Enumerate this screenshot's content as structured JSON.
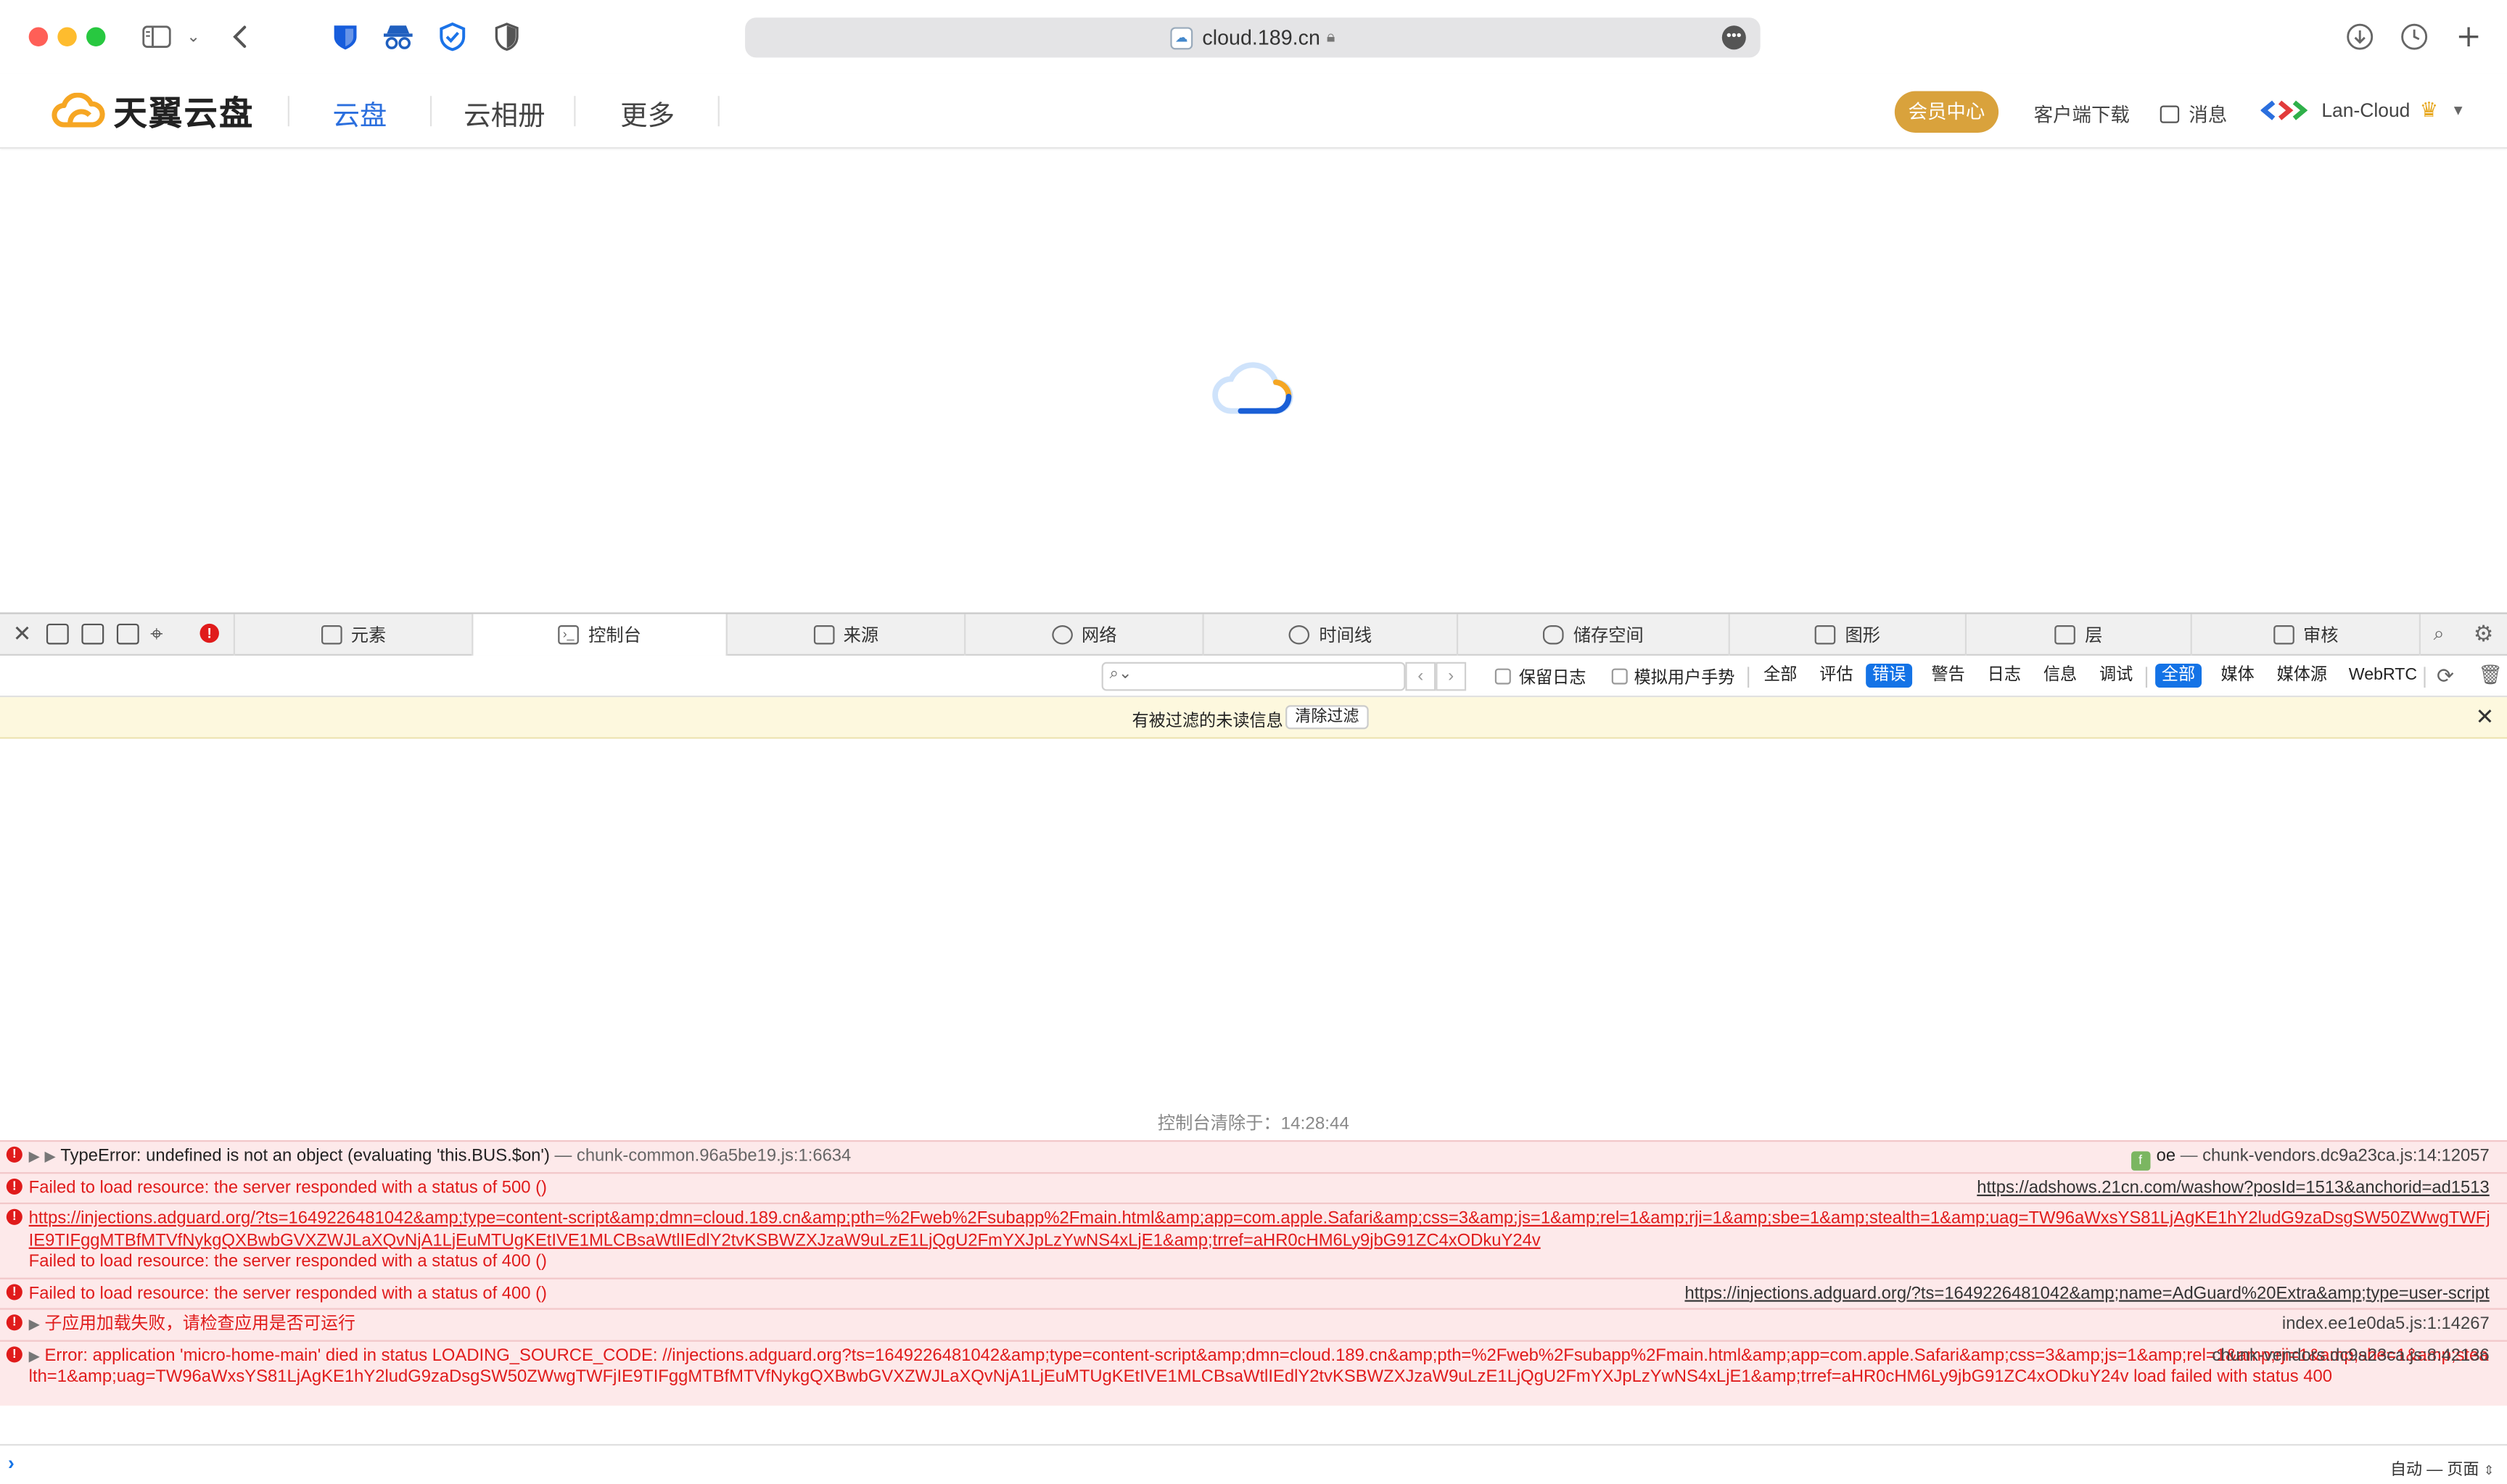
{
  "browser": {
    "url": "cloud.189.cn",
    "traffic_colors": {
      "close": "#ff5f57",
      "min": "#febc2e",
      "max": "#28c840"
    }
  },
  "site": {
    "logo_text": "天翼云盘",
    "nav": [
      "云盘",
      "云相册",
      "更多"
    ],
    "vip_label": "会员中心",
    "download_label": "客户端下载",
    "message_label": "消息",
    "user_name": "Lan-Cloud",
    "accent_color": "#2b6fde",
    "vip_color": "#d9a23c"
  },
  "devtools": {
    "tabs": [
      "元素",
      "控制台",
      "来源",
      "网络",
      "时间线",
      "储存空间",
      "图形",
      "层",
      "审核"
    ],
    "active_tab": "控制台",
    "filter_placeholder": "",
    "preserve_log_label": "保留日志",
    "simulate_gesture_label": "模拟用户手势",
    "level_filters": [
      "全部",
      "评估",
      "错误",
      "警告",
      "日志",
      "信息",
      "调试"
    ],
    "active_level": "错误",
    "source_filters": [
      "全部",
      "媒体",
      "媒体源",
      "WebRTC"
    ],
    "active_source": "全部",
    "notice_text": "有被过滤的未读信息",
    "notice_button": "清除过滤",
    "clear_note": "控制台清除于：14:28:44",
    "prompt_context": "自动 — 页面",
    "error_color": "#e01b1b"
  },
  "logs": [
    {
      "message": "TypeError: undefined is not an object (evaluating 'this.BUS.$on')",
      "sep": " — ",
      "origin": "chunk-common.96a5be19.js:1:6634",
      "fn_badge": "f",
      "fn_name": "oe",
      "fn_sep": " — ",
      "source": "chunk-vendors.dc9a23ca.js:14:12057"
    },
    {
      "message": "Failed to load resource: the server responded with a status of 500 ()",
      "source": "https://adshows.21cn.com/washow?posId=1513&anchorid=ad1513"
    },
    {
      "url": "https://injections.adguard.org/?ts=1649226481042&amp;type=content-script&amp;dmn=cloud.189.cn&amp;pth=%2Fweb%2Fsubapp%2Fmain.html&amp;app=com.apple.Safari&amp;css=3&amp;js=1&amp;rel=1&amp;rji=1&amp;sbe=1&amp;stealth=1&amp;uag=TW96aWxsYS81LjAgKE1hY2ludG9zaDsgSW50ZWwgTWFjIE9TIFggMTBfMTVfNykgQXBwbGVXZWJLaXQvNjA1LjEuMTUgKEtIVE1MLCBsaWtlIEdlY2tvKSBWZXJzaW9uLzE1LjQgU2FmYXJpLzYwNS4xLjE1&amp;trref=aHR0cHM6Ly9jbG91ZC4xODkuY24v",
      "message": "Failed to load resource: the server responded with a status of 400 ()"
    },
    {
      "message": "Failed to load resource: the server responded with a status of 400 ()",
      "source": "https://injections.adguard.org/?ts=1649226481042&amp;name=AdGuard%20Extra&amp;type=user-script"
    },
    {
      "message": "子应用加载失败，请检查应用是否可运行",
      "source": "index.ee1e0da5.js:1:14267"
    },
    {
      "message": "Error: application 'micro-home-main' died in status LOADING_SOURCE_CODE: //injections.adguard.org?ts=1649226481042&amp;type=content-script&amp;dmn=cloud.189.cn&amp;pth=%2Fweb%2Fsubapp%2Fmain.html&amp;app=com.apple.Safari&amp;css=3&amp;js=1&amp;rel=1&amp;rji=1&amp;sbe=1&amp;stealth=1&amp;uag=TW96aWxsYS81LjAgKE1hY2ludG9zaDsgSW50ZWwgTWFjIE9TIFggMTBfMTVfNykgQXBwbGVXZWJLaXQvNjA1LjEuMTUgKEtIVE1MLCBsaWtlIEdlY2tvKSBWZXJzaW9uLzE1LjQgU2FmYXJpLzYwNS4xLjE1&amp;trref=aHR0cHM6Ly9jbG91ZC4xODkuY24v load failed with status 400",
      "source": "chunk-vendors.dc9a23ca.js:8:42136"
    }
  ]
}
